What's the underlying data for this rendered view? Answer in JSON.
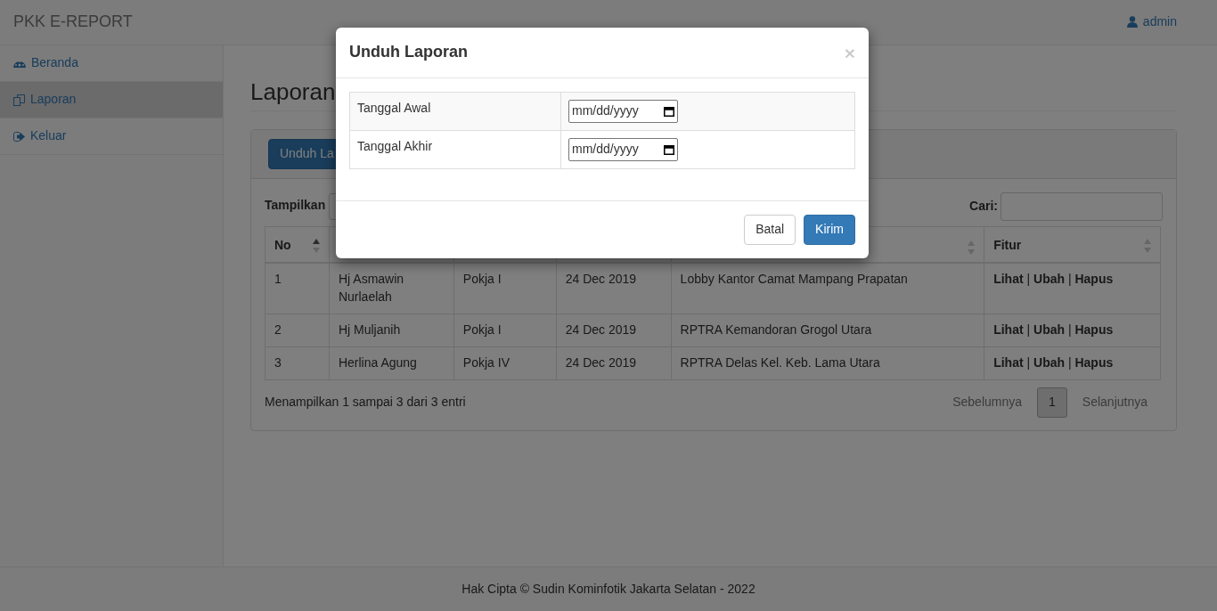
{
  "navbar": {
    "brand": "PKK E-REPORT",
    "user": "admin"
  },
  "sidebar": {
    "items": [
      {
        "label": "Beranda",
        "selected": false
      },
      {
        "label": "Laporan",
        "selected": true
      },
      {
        "label": "Keluar",
        "selected": false
      }
    ]
  },
  "page": {
    "title": "Laporan",
    "download_button": "Unduh La",
    "show_label": "Tampilkan",
    "search_label": "Cari:",
    "table": {
      "columns": [
        {
          "label": "No",
          "sorted": true
        },
        {},
        {},
        {},
        {
          "sorted": false
        },
        {
          "label": "Fitur",
          "sorted": false
        }
      ],
      "action_separator": "|",
      "rows": [
        {
          "cells": [
            "1",
            "Hj Asmawin Nurlaelah",
            "Pokja I",
            "24 Dec 2019",
            "Lobby Kantor Camat Mampang Prapatan"
          ],
          "actions": [
            "Lihat",
            "Ubah",
            "Hapus"
          ]
        },
        {
          "cells": [
            "2",
            "Hj Muljanih",
            "Pokja I",
            "24 Dec 2019",
            "RPTRA Kemandoran Grogol Utara"
          ],
          "actions": [
            "Lihat",
            "Ubah",
            "Hapus"
          ]
        },
        {
          "cells": [
            "3",
            "Herlina Agung",
            "Pokja IV",
            "24 Dec 2019",
            "RPTRA Delas Kel. Keb. Lama Utara"
          ],
          "actions": [
            "Lihat",
            "Ubah",
            "Hapus"
          ]
        }
      ]
    },
    "info": "Menampilkan 1 sampai 3 dari 3 entri",
    "pagination": {
      "previous": "Sebelumnya",
      "pages": [
        {
          "label": "1",
          "selected": true
        }
      ],
      "next": "Selanjutnya"
    }
  },
  "footer": {
    "text": "Hak Cipta © Sudin Kominfotik Jakarta Selatan - 2022"
  },
  "modal": {
    "title": "Unduh Laporan",
    "close": "×",
    "fields": [
      {
        "label": "Tanggal Awal",
        "placeholder": "mm/dd/yyyy"
      },
      {
        "label": "Tanggal Akhir",
        "placeholder": "mm/dd/yyyy"
      }
    ],
    "buttons": [
      {
        "label": "Batal",
        "kind": "default"
      },
      {
        "label": "Kirim",
        "kind": "primary"
      }
    ]
  }
}
